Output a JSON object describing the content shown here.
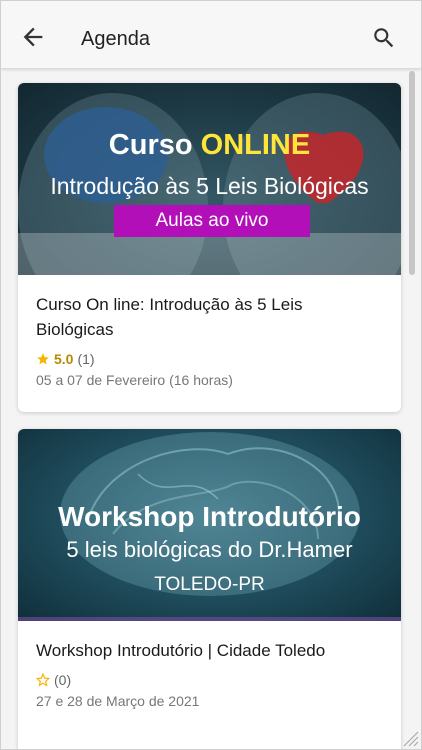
{
  "appbar": {
    "title": "Agenda"
  },
  "events": [
    {
      "banner": {
        "line1_prefix": "Curso ",
        "line1_highlight": "ONLINE",
        "line2": "Introdução às 5 Leis Biológicas",
        "tag": "Aulas ao vivo"
      },
      "title": "Curso On line: Introdução às 5 Leis Biológicas",
      "rating_score": "5.0",
      "rating_count": "(1)",
      "date": "05 a 07 de Fevereiro (16 horas)"
    },
    {
      "banner": {
        "line1": "Workshop Introdutório",
        "line2": "5 leis biológicas do Dr.Hamer",
        "line3": "TOLEDO-PR"
      },
      "title": "Workshop Introdutório | Cidade Toledo",
      "rating_count": "(0)",
      "date": "27 e 28 de Março de 2021"
    }
  ],
  "colors": {
    "star_filled": "#f5b400",
    "banner_tag": "#b20fb8",
    "banner_highlight": "#ffe53a"
  },
  "icons": [
    "back-arrow-icon",
    "search-icon",
    "star-filled-icon",
    "star-outline-icon",
    "resize-grip-icon"
  ]
}
